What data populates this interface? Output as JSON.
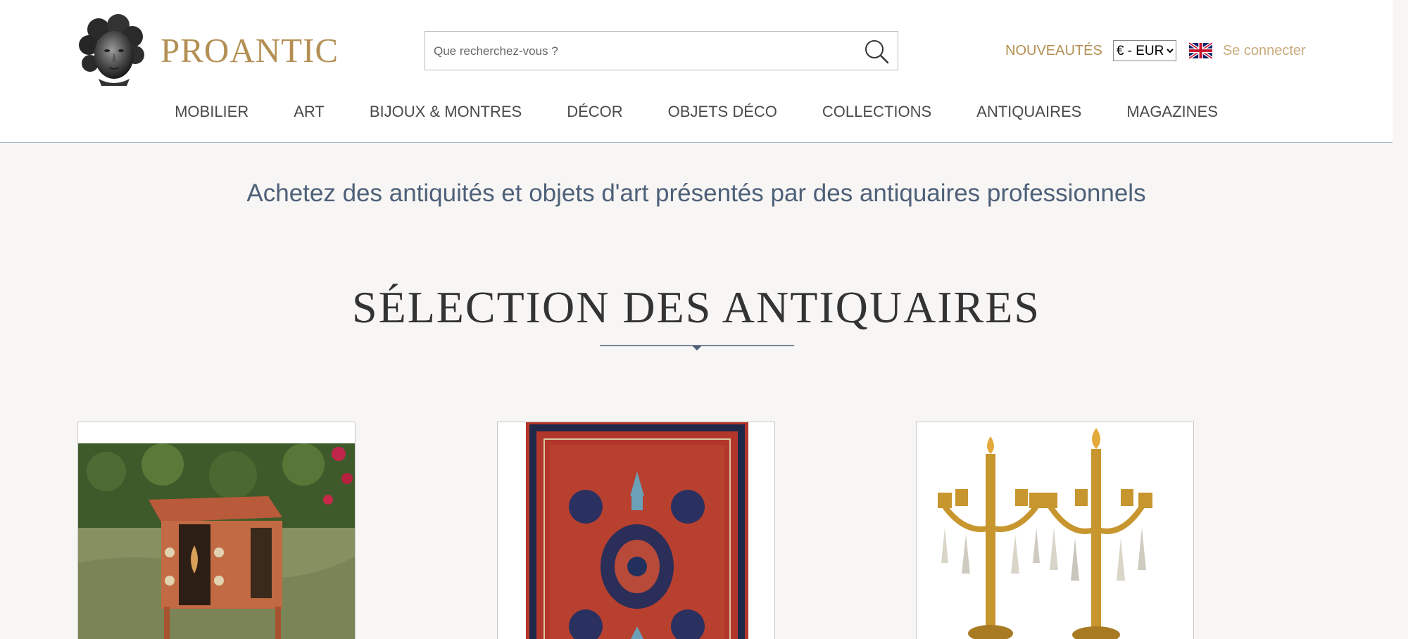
{
  "header": {
    "logo_text": "PROANTIC",
    "search": {
      "placeholder": "Que recherchez-vous ?",
      "value": ""
    },
    "nouveautes": "NOUVEAUTÉS",
    "currency": {
      "selected": "€ - EUR",
      "options": [
        "€ - EUR"
      ]
    },
    "language_flag": "uk-flag-icon",
    "login": "Se connecter"
  },
  "nav": {
    "items": [
      "MOBILIER",
      "ART",
      "BIJOUX & MONTRES",
      "DÉCOR",
      "OBJETS DÉCO",
      "COLLECTIONS",
      "ANTIQUAIRES",
      "MAGAZINES"
    ]
  },
  "main": {
    "tagline": "Achetez des antiquités et objets d'art présentés par des antiquaires professionnels",
    "section_title": "SÉLECTION DES ANTIQUAIRES",
    "products": [
      {
        "image": "commode-marquetry-image"
      },
      {
        "image": "persian-rug-image"
      },
      {
        "image": "gilt-candelabra-pair-image"
      }
    ]
  },
  "colors": {
    "brand_gold": "#b38f54",
    "login_gold": "#c9ab7c",
    "tagline_blue": "#4e6079",
    "background": "#f7f6f4"
  }
}
